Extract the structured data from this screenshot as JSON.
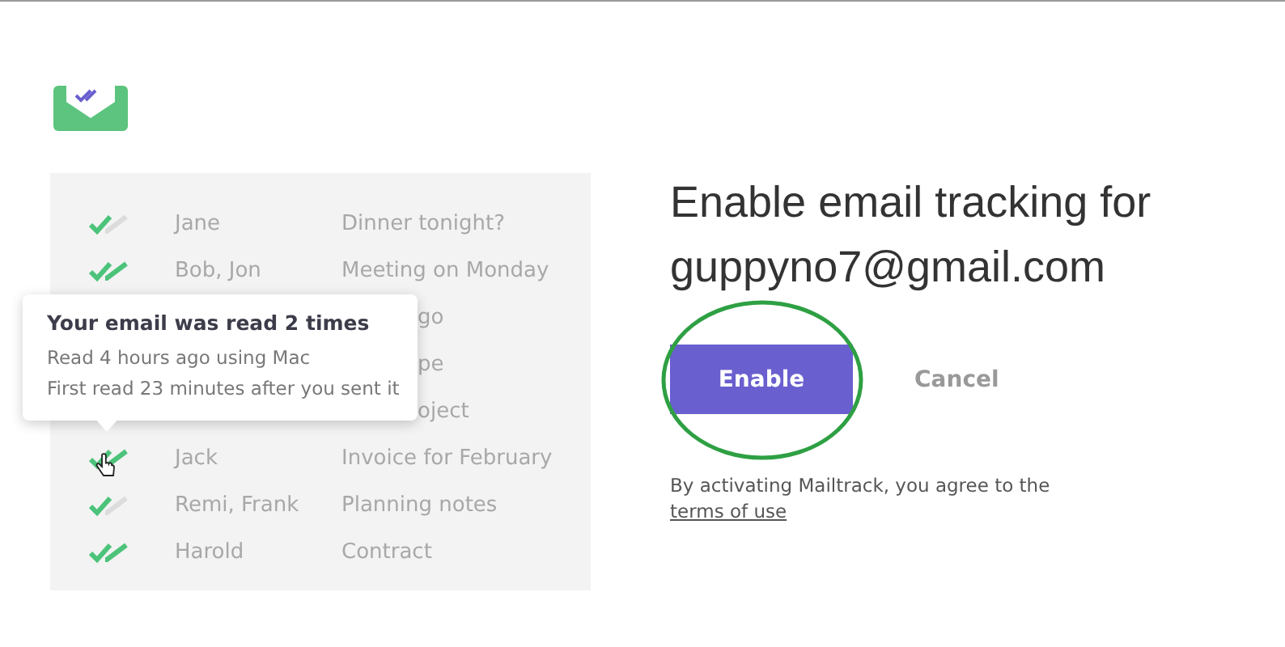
{
  "inbox_preview": {
    "rows": [
      {
        "kind": "full",
        "name": "Jane",
        "subject": "Dinner tonight?",
        "read": false
      },
      {
        "kind": "full",
        "name": "Bob, Jon",
        "subject": "Meeting on Monday",
        "read": true
      },
      {
        "kind": "partial",
        "subject": "go"
      },
      {
        "kind": "partial",
        "subject": "pe"
      },
      {
        "kind": "partial",
        "subject": "oject"
      },
      {
        "kind": "full",
        "name": "Jack",
        "subject": "Invoice for February",
        "read": true
      },
      {
        "kind": "full",
        "name": "Remi, Frank",
        "subject": "Planning notes",
        "read": false
      },
      {
        "kind": "full",
        "name": "Harold",
        "subject": "Contract",
        "read": true
      }
    ],
    "tooltip": {
      "title": "Your email was read 2 times",
      "lines": [
        "Read 4 hours ago using Mac",
        "First read 23 minutes after you sent it"
      ]
    }
  },
  "heading": "Enable email tracking for guppyno7@gmail.com",
  "buttons": [
    {
      "kind": "primary",
      "label": "Enable"
    },
    {
      "kind": "secondary",
      "label": "Cancel"
    }
  ],
  "agreement": {
    "text": "By activating Mailtrack, you agree to the",
    "link": "terms of use"
  }
}
